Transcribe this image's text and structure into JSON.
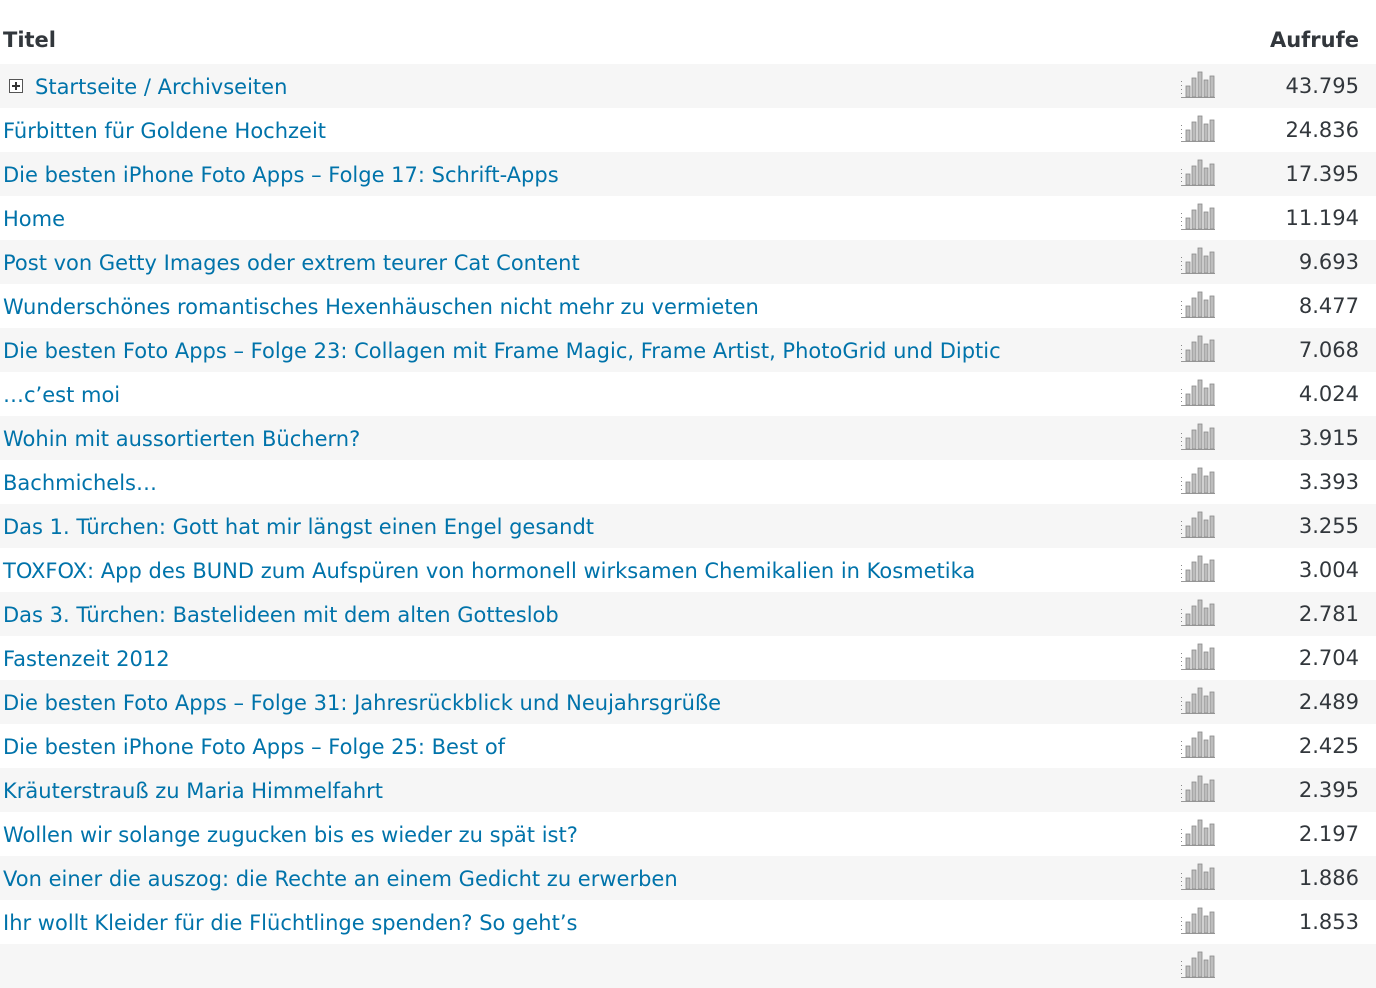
{
  "table": {
    "header": {
      "title_label": "Titel",
      "views_label": "Aufrufe"
    },
    "rows": [
      {
        "title": "Startseite / Archivseiten",
        "views": "43.795",
        "expandable": true
      },
      {
        "title": "Fürbitten für Goldene Hochzeit",
        "views": "24.836"
      },
      {
        "title": "Die besten iPhone Foto Apps – Folge 17: Schrift-Apps",
        "views": "17.395"
      },
      {
        "title": "Home",
        "views": "11.194"
      },
      {
        "title": "Post von Getty Images oder extrem teurer Cat Content",
        "views": "9.693"
      },
      {
        "title": "Wunderschönes romantisches Hexenhäuschen nicht mehr zu vermieten",
        "views": "8.477"
      },
      {
        "title": "Die besten Foto Apps – Folge 23: Collagen mit Frame Magic, Frame Artist, PhotoGrid und Diptic",
        "views": "7.068"
      },
      {
        "title": "…c’est moi",
        "views": "4.024"
      },
      {
        "title": "Wohin mit aussortierten Büchern?",
        "views": "3.915"
      },
      {
        "title": "Bachmichels…",
        "views": "3.393"
      },
      {
        "title": "Das 1. Türchen: Gott hat mir längst einen Engel gesandt",
        "views": "3.255"
      },
      {
        "title": "TOXFOX: App des BUND zum Aufspüren von hormonell wirksamen Chemikalien in Kosmetika",
        "views": "3.004"
      },
      {
        "title": "Das 3. Türchen: Bastelideen mit dem alten Gotteslob",
        "views": "2.781"
      },
      {
        "title": "Fastenzeit 2012",
        "views": "2.704"
      },
      {
        "title": "Die besten Foto Apps – Folge 31: Jahresrückblick und Neujahrsgrüße",
        "views": "2.489"
      },
      {
        "title": "Die besten iPhone Foto Apps – Folge 25: Best of",
        "views": "2.425"
      },
      {
        "title": "Kräuterstrauß zu Maria Himmelfahrt",
        "views": "2.395"
      },
      {
        "title": "Wollen wir solange zugucken bis es wieder zu spät ist?",
        "views": "2.197"
      },
      {
        "title": "Von einer die auszog: die Rechte an einem Gedicht zu erwerben",
        "views": "1.886"
      },
      {
        "title": "Ihr wollt Kleider für die Flüchtlinge spenden? So geht’s",
        "views": "1.853"
      },
      {
        "title": "",
        "views": ""
      }
    ],
    "icon": "bar-chart-icon",
    "colors": {
      "link": "#0073aa",
      "text": "#32373c",
      "stripe": "#f6f6f6"
    }
  }
}
